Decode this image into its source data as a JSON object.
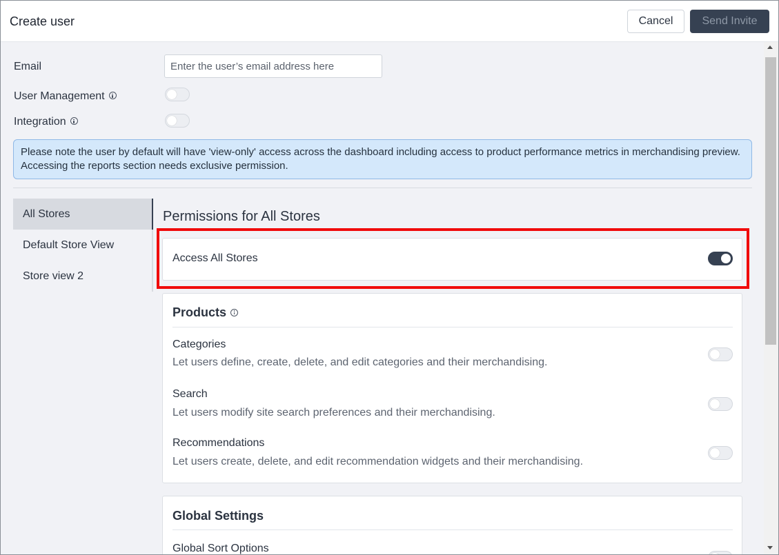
{
  "header": {
    "title": "Create user",
    "cancel_label": "Cancel",
    "send_invite_label": "Send Invite"
  },
  "form": {
    "email_label": "Email",
    "email_placeholder": "Enter the user’s email address here",
    "email_value": "",
    "user_management_label": "User Management",
    "user_management_on": false,
    "integration_label": "Integration",
    "integration_on": false
  },
  "notice": {
    "text": "Please note the user by default will have 'view-only' access across the dashboard including access to product performance metrics in merchandising preview. Accessing the reports section needs exclusive permission."
  },
  "sidebar": {
    "items": [
      {
        "label": "All Stores",
        "active": true
      },
      {
        "label": "Default Store View",
        "active": false
      },
      {
        "label": "Store view 2",
        "active": false
      }
    ]
  },
  "permissions": {
    "title": "Permissions for All Stores",
    "access_all_stores": {
      "label": "Access All Stores",
      "on": true
    },
    "products": {
      "heading": "Products",
      "rows": [
        {
          "title": "Categories",
          "desc": "Let users define, create, delete, and edit categories and their merchandising.",
          "on": false
        },
        {
          "title": "Search",
          "desc": "Let users modify site search preferences and their merchandising.",
          "on": false
        },
        {
          "title": "Recommendations",
          "desc": "Let users create, delete, and edit recommendation widgets and their merchandising.",
          "on": false
        }
      ]
    },
    "global_settings": {
      "heading": "Global Settings",
      "rows": [
        {
          "title": "Global Sort Options",
          "on": false
        }
      ]
    }
  },
  "colors": {
    "highlight": "#f00b0b",
    "toggle_on": "#364152",
    "notice_bg": "#d4e8fb"
  }
}
